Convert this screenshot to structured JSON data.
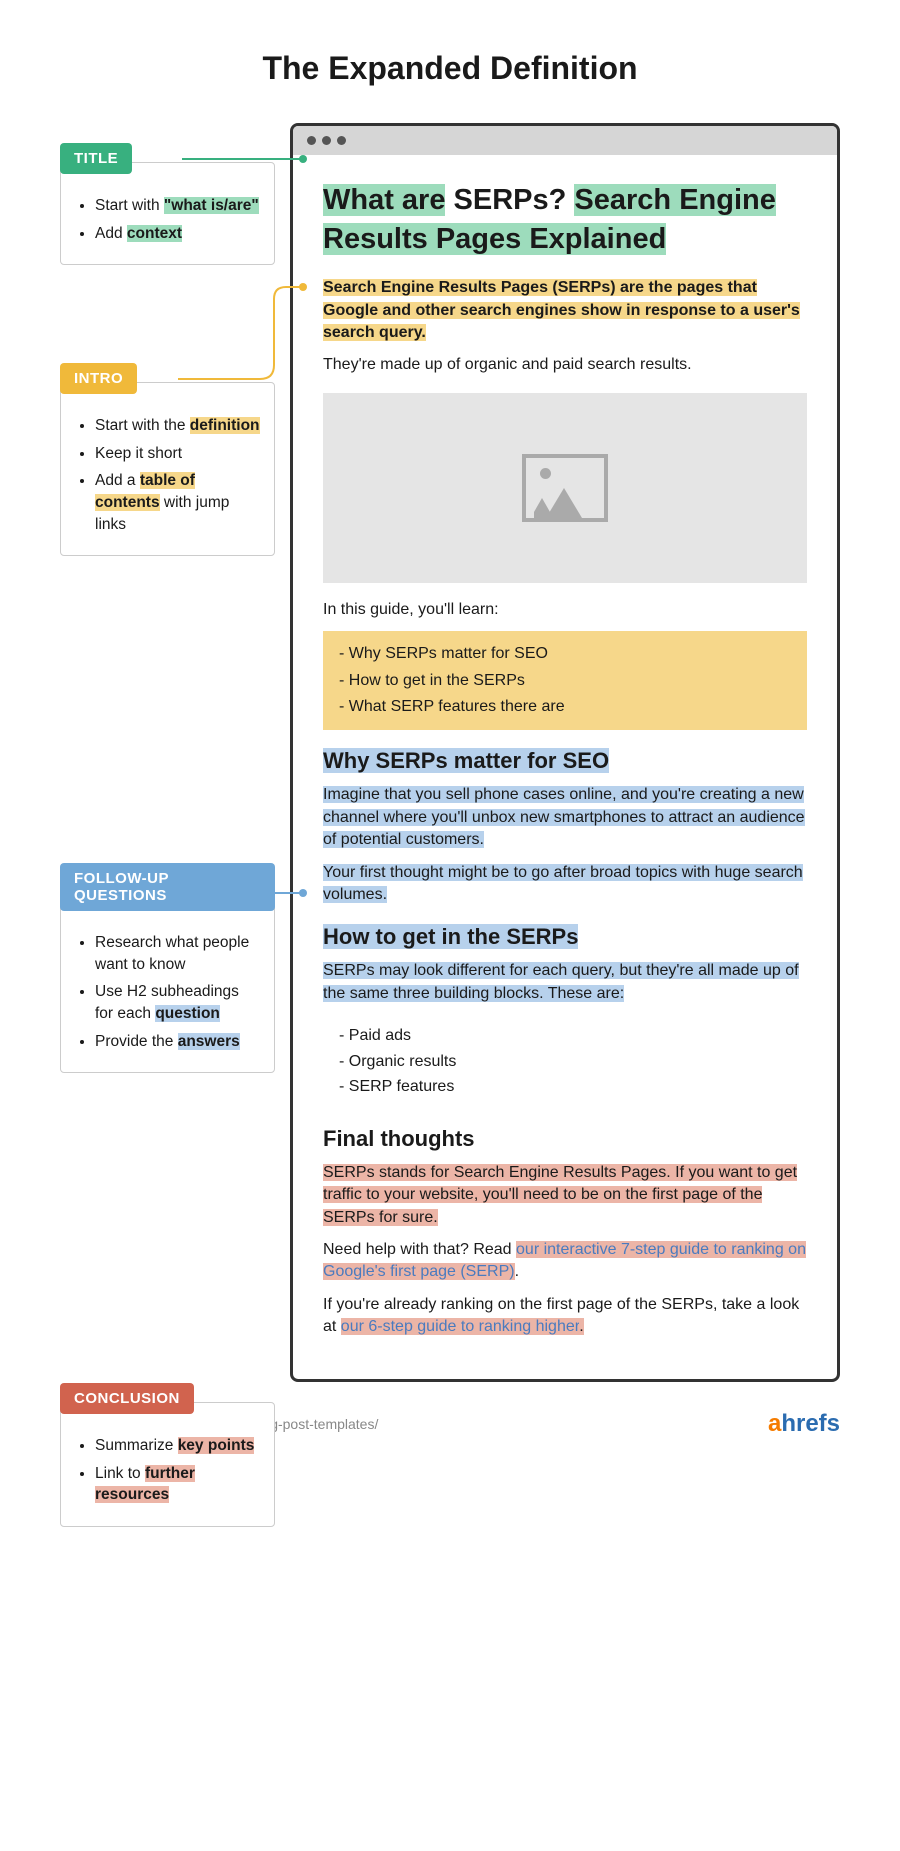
{
  "title": "The Expanded Definition",
  "annotations": {
    "title": {
      "label": "TITLE",
      "tips": [
        {
          "pre": "Start with ",
          "hl": "\"what is/are\"",
          "post": ""
        },
        {
          "pre": "Add ",
          "hl": "context",
          "post": ""
        }
      ]
    },
    "intro": {
      "label": "INTRO",
      "tips": [
        {
          "pre": "Start with the ",
          "hl": "definition",
          "post": ""
        },
        {
          "pre": "Keep it short",
          "hl": "",
          "post": ""
        },
        {
          "pre": "Add a ",
          "hl": "table of contents",
          "post": " with jump links"
        }
      ]
    },
    "followup": {
      "label": "FOLLOW-UP QUESTIONS",
      "tips": [
        {
          "pre": "Research what people want to know",
          "hl": "",
          "post": ""
        },
        {
          "pre": "Use H2 subheadings for each ",
          "hl": "question",
          "post": ""
        },
        {
          "pre": "Provide the ",
          "hl": "answers",
          "post": ""
        }
      ]
    },
    "conclusion": {
      "label": "CONCLUSION",
      "tips": [
        {
          "pre": "Summarize ",
          "hl": "key points",
          "post": ""
        },
        {
          "pre": "Link to ",
          "hl": "further resources",
          "post": ""
        }
      ]
    }
  },
  "article": {
    "heading_part1": "What are",
    "heading_part2": " SERPs? ",
    "heading_part3": "Search Engine Results Pages Explained",
    "intro_hl": "Search Engine Results Pages (SERPs) are the pages that Google and other search engines show in response to a user's search query.",
    "intro_after": "They're made up of organic and paid search results.",
    "guide_lead": "In this guide, you'll learn:",
    "toc": [
      "Why SERPs matter for SEO",
      "How to get in the SERPs",
      "What SERP features there are"
    ],
    "h2_a": "Why SERPs matter for SEO",
    "p_a1": "Imagine that you sell phone cases online, and you're creating a new channel where you'll unbox new smartphones to attract an audience of potential customers.",
    "p_a2": "Your first thought might be to go after broad topics with huge search volumes.",
    "h2_b": "How to get in the SERPs",
    "p_b1": "SERPs may look different for each query, but they're all made up of the same three building blocks. These are:",
    "building_blocks": [
      "Paid ads",
      "Organic results",
      "SERP features"
    ],
    "h2_c": "Final thoughts",
    "concl1": "SERPs stands for Search Engine Results Pages. If you want to get traffic to your website, you'll need to be on the first page of the SERPs for sure.",
    "concl2_pre": "Need help with that? Read ",
    "concl2_link": "our interactive 7-step guide to ranking on Google's first page (SERP)",
    "concl2_post": ".",
    "concl3_pre": "If you're already ranking on the first page of the SERPs, take a look at ",
    "concl3_link": "our 6-step guide to ranking higher",
    "concl3_post": "."
  },
  "footer": {
    "url": "https://ahrefs.com/blog/blog-post-templates/",
    "brand_a": "a",
    "brand_rest": "hrefs"
  }
}
